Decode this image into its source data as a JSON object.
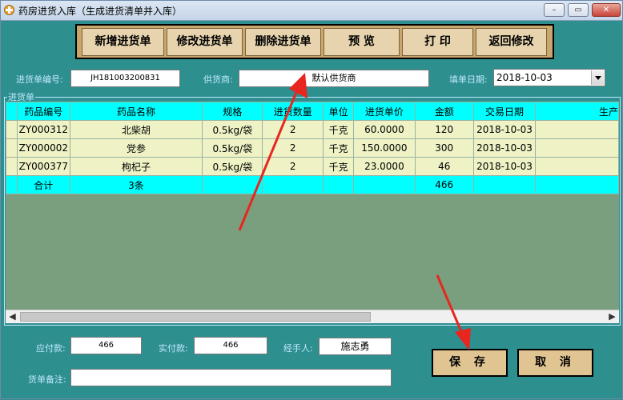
{
  "window": {
    "title": "药房进货入库（生成进货清单并入库）",
    "controls": {
      "minimize": "–",
      "maximize": "▭",
      "close": "✕"
    }
  },
  "toolbar": {
    "buttons": [
      "新增进货单",
      "修改进货单",
      "删除进货单",
      "预 览",
      "打 印",
      "返回修改"
    ]
  },
  "header": {
    "order_no_label": "进货单编号:",
    "order_no_value": "JH181003200831",
    "supplier_label": "供货商:",
    "supplier_value": "默认供货商",
    "date_label": "填单日期:",
    "date_value": "2018-10-03"
  },
  "group_label": "进货单",
  "table": {
    "columns": [
      "药品编号",
      "药品名称",
      "规格",
      "进货数量",
      "单位",
      "进货单价",
      "金额",
      "交易日期",
      "生产"
    ],
    "rows": [
      [
        "ZY000312",
        "北柴胡",
        "0.5kg/袋",
        "2",
        "千克",
        "60.0000",
        "120",
        "2018-10-03",
        ""
      ],
      [
        "ZY000002",
        "党参",
        "0.5kg/袋",
        "2",
        "千克",
        "150.0000",
        "300",
        "2018-10-03",
        ""
      ],
      [
        "ZY000377",
        "枸杞子",
        "0.5kg/袋",
        "2",
        "千克",
        "23.0000",
        "46",
        "2018-10-03",
        ""
      ]
    ],
    "total": [
      "合计",
      "3条",
      "",
      "",
      "",
      "",
      "466",
      "",
      ""
    ]
  },
  "footer": {
    "payable_label": "应付款:",
    "payable_value": "466",
    "paid_label": "实付款:",
    "paid_value": "466",
    "handler_label": "经手人:",
    "handler_value": "施志勇",
    "remark_label": "货单备注:",
    "remark_value": "",
    "save_label": "保 存",
    "cancel_label": "取 消"
  },
  "annotation_color": "#e8261f"
}
